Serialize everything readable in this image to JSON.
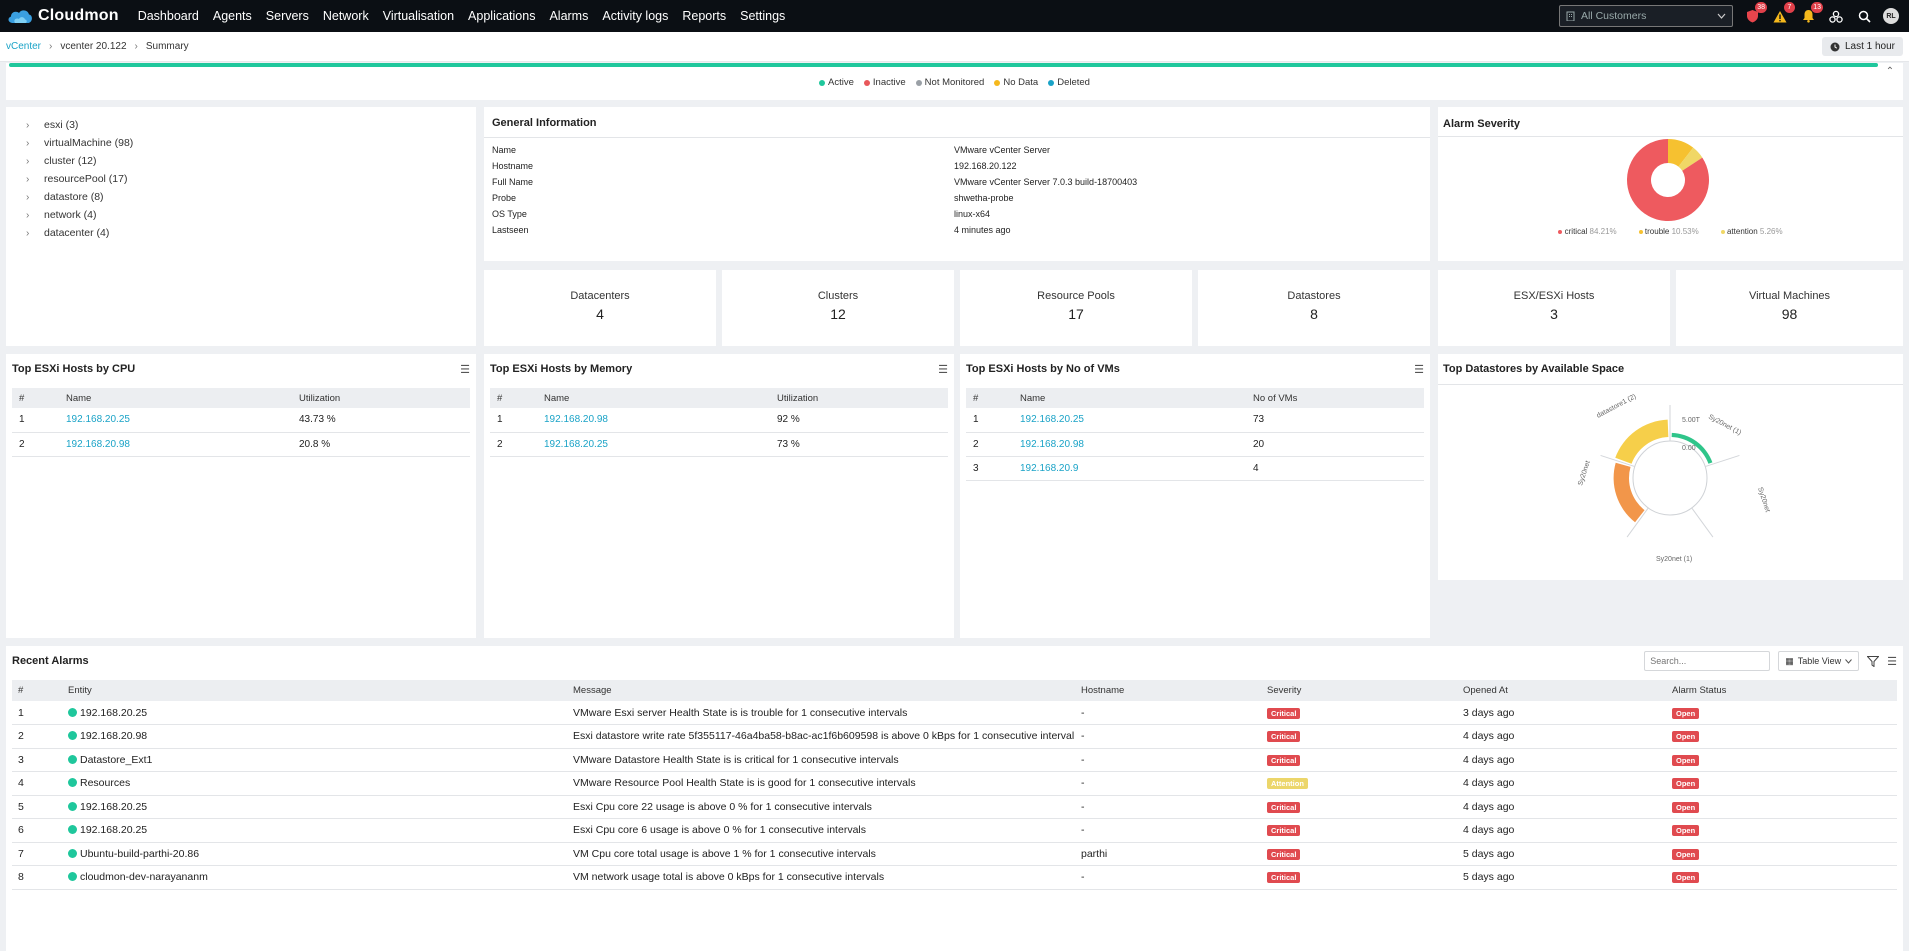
{
  "app": {
    "name": "Cloudmon"
  },
  "nav": {
    "items": [
      "Dashboard",
      "Agents",
      "Servers",
      "Network",
      "Virtualisation",
      "Applications",
      "Alarms",
      "Activity logs",
      "Reports",
      "Settings"
    ]
  },
  "header": {
    "customer_select": "All Customers",
    "badges": {
      "alerts_red": "38",
      "alerts_warning": "7",
      "notifications": "13"
    },
    "avatar_initials": "RL"
  },
  "breadcrumb": {
    "root": "vCenter",
    "item": "vcenter 20.122",
    "current": "Summary"
  },
  "time_range": "Last 1 hour",
  "status_legend": [
    {
      "label": "Active",
      "color": "#1fc79c"
    },
    {
      "label": "Inactive",
      "color": "#e8575a"
    },
    {
      "label": "Not Monitored",
      "color": "#9aa0a6"
    },
    {
      "label": "No Data",
      "color": "#f5b81c"
    },
    {
      "label": "Deleted",
      "color": "#1aa3c7"
    }
  ],
  "tree": [
    {
      "label": "esxi (3)"
    },
    {
      "label": "virtualMachine (98)"
    },
    {
      "label": "cluster (12)"
    },
    {
      "label": "resourcePool (17)"
    },
    {
      "label": "datastore (8)"
    },
    {
      "label": "network (4)"
    },
    {
      "label": "datacenter (4)"
    }
  ],
  "general_info": {
    "title": "General Information",
    "rows": [
      {
        "key": "Name",
        "value": "VMware vCenter Server"
      },
      {
        "key": "Hostname",
        "value": "192.168.20.122"
      },
      {
        "key": "Full Name",
        "value": "VMware vCenter Server 7.0.3 build-18700403"
      },
      {
        "key": "Probe",
        "value": "shwetha-probe"
      },
      {
        "key": "OS Type",
        "value": "linux-x64"
      },
      {
        "key": "Lastseen",
        "value": "4 minutes ago"
      }
    ]
  },
  "alarm_severity": {
    "title": "Alarm Severity",
    "items": [
      {
        "label": "critical",
        "pct": "84.21%",
        "value": 84.21,
        "color": "#ee5a5f"
      },
      {
        "label": "trouble",
        "pct": "10.53%",
        "value": 10.53,
        "color": "#f6c130"
      },
      {
        "label": "attention",
        "pct": "5.26%",
        "value": 5.26,
        "color": "#f0d766"
      }
    ]
  },
  "stats": [
    {
      "label": "Datacenters",
      "value": "4"
    },
    {
      "label": "Clusters",
      "value": "12"
    },
    {
      "label": "Resource Pools",
      "value": "17"
    },
    {
      "label": "Datastores",
      "value": "8"
    },
    {
      "label": "ESX/ESXi Hosts",
      "value": "3"
    },
    {
      "label": "Virtual Machines",
      "value": "98"
    }
  ],
  "top_cpu": {
    "title": "Top ESXi Hosts by CPU",
    "headers": [
      "#",
      "Name",
      "Utilization"
    ],
    "rows": [
      {
        "n": "1",
        "name": "192.168.20.25",
        "val": "43.73 %"
      },
      {
        "n": "2",
        "name": "192.168.20.98",
        "val": "20.8 %"
      }
    ]
  },
  "top_mem": {
    "title": "Top ESXi Hosts by Memory",
    "headers": [
      "#",
      "Name",
      "Utilization"
    ],
    "rows": [
      {
        "n": "1",
        "name": "192.168.20.98",
        "val": "92 %"
      },
      {
        "n": "2",
        "name": "192.168.20.25",
        "val": "73 %"
      }
    ]
  },
  "top_vms": {
    "title": "Top ESXi Hosts by No of VMs",
    "headers": [
      "#",
      "Name",
      "No of VMs"
    ],
    "rows": [
      {
        "n": "1",
        "name": "192.168.20.25",
        "val": "73"
      },
      {
        "n": "2",
        "name": "192.168.20.98",
        "val": "20"
      },
      {
        "n": "3",
        "name": "192.168.20.9",
        "val": "4"
      }
    ]
  },
  "top_datastores": {
    "title": "Top Datastores by Available Space",
    "scale_labels": [
      "5.00T",
      "0.00"
    ],
    "segment_labels": [
      "datastore1 (2)",
      "Sy20net (1)",
      "Sy20net",
      "Sy20net (1)",
      "Sy20net"
    ],
    "bars": [
      {
        "label": "datastore1 (2)",
        "fraction": 0.15,
        "color": "#2fc58a"
      },
      {
        "label": "Sy20net (1)",
        "fraction": 0.0,
        "color": "#2fc58a"
      },
      {
        "label": "Sy20net",
        "fraction": 0.0,
        "color": "#2fc58a"
      },
      {
        "label": "Sy20net (1)",
        "fraction": 0.55,
        "color": "#f2964a"
      },
      {
        "label": "Sy20net",
        "fraction": 0.62,
        "color": "#f6cf4a"
      }
    ]
  },
  "recent_alarms": {
    "title": "Recent Alarms",
    "search_placeholder": "Search...",
    "view_label": "Table View",
    "headers": [
      "#",
      "Entity",
      "Message",
      "Hostname",
      "Severity",
      "Opened At",
      "Alarm Status"
    ],
    "rows": [
      {
        "n": "1",
        "entity": "192.168.20.25",
        "message": "VMware Esxi server Health State is is trouble for 1 consecutive intervals",
        "host": "-",
        "sev": "Critical",
        "opened": "3 days ago",
        "status": "Open"
      },
      {
        "n": "2",
        "entity": "192.168.20.98",
        "message": "Esxi datastore write rate 5f355117-46a4ba58-b8ac-ac1f6b609598 is above 0 kBps for 1 consecutive interval",
        "host": "-",
        "sev": "Critical",
        "opened": "4 days ago",
        "status": "Open"
      },
      {
        "n": "3",
        "entity": "Datastore_Ext1",
        "message": "VMware Datastore Health State is is critical for 1 consecutive intervals",
        "host": "-",
        "sev": "Critical",
        "opened": "4 days ago",
        "status": "Open"
      },
      {
        "n": "4",
        "entity": "Resources",
        "message": "VMware Resource Pool Health State is is good for 1 consecutive intervals",
        "host": "-",
        "sev": "Attention",
        "opened": "4 days ago",
        "status": "Open"
      },
      {
        "n": "5",
        "entity": "192.168.20.25",
        "message": "Esxi Cpu core 22 usage is above 0 % for 1 consecutive intervals",
        "host": "-",
        "sev": "Critical",
        "opened": "4 days ago",
        "status": "Open"
      },
      {
        "n": "6",
        "entity": "192.168.20.25",
        "message": "Esxi Cpu core 6 usage is above 0 % for 1 consecutive intervals",
        "host": "-",
        "sev": "Critical",
        "opened": "4 days ago",
        "status": "Open"
      },
      {
        "n": "7",
        "entity": "Ubuntu-build-parthi-20.86",
        "message": "VM Cpu core total usage is above 1 % for 1 consecutive intervals",
        "host": "parthi",
        "sev": "Critical",
        "opened": "5 days ago",
        "status": "Open"
      },
      {
        "n": "8",
        "entity": "cloudmon-dev-narayananm",
        "message": "VM network usage total is above 0 kBps for 1 consecutive intervals",
        "host": "-",
        "sev": "Critical",
        "opened": "5 days ago",
        "status": "Open"
      }
    ]
  }
}
